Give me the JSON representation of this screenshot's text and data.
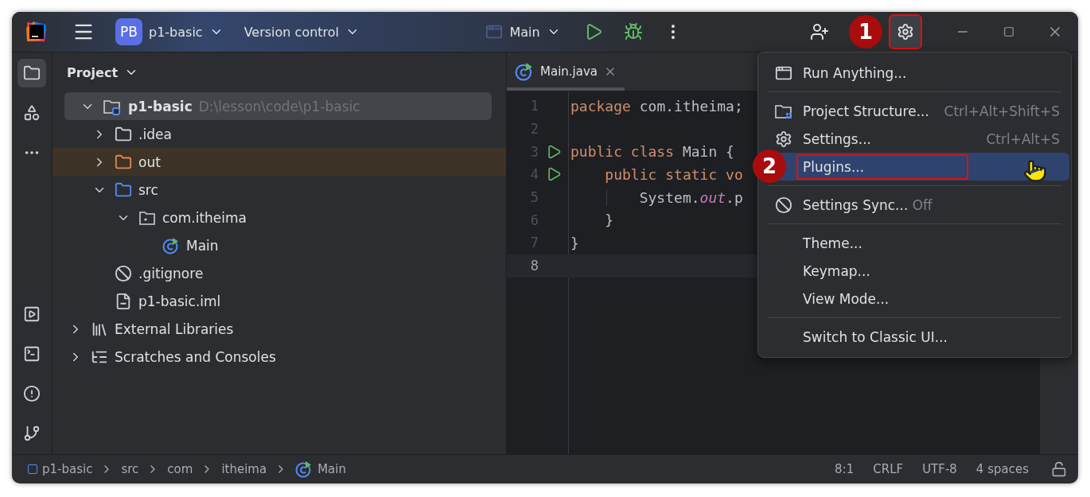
{
  "title_bar": {
    "project_badge": "PB",
    "project": "p1-basic",
    "vcs": "Version control",
    "run_config": "Main",
    "annotation": "1"
  },
  "left_toolbar": {
    "top": [
      {
        "kind": "project",
        "selected": true
      },
      {
        "kind": "structure",
        "selected": false
      },
      {
        "kind": "more",
        "selected": false
      }
    ],
    "bottom": [
      {
        "kind": "run",
        "selected": false
      },
      {
        "kind": "terminal",
        "selected": false
      },
      {
        "kind": "problems",
        "selected": false
      },
      {
        "kind": "git",
        "selected": false
      }
    ]
  },
  "project_panel": {
    "title": "Project",
    "tree": [
      {
        "kind": "module",
        "label": "p1-basic",
        "path": "D:\\lesson\\code\\p1-basic",
        "expanded": true,
        "selected": true,
        "children": [
          {
            "kind": "folder",
            "label": ".idea",
            "expanded": false,
            "selected": false
          },
          {
            "kind": "excluded",
            "label": "out",
            "expanded": false,
            "selected": false
          },
          {
            "kind": "source",
            "label": "src",
            "expanded": true,
            "selected": false,
            "children": [
              {
                "kind": "package",
                "label": "com.itheima",
                "expanded": true,
                "selected": false,
                "children": [
                  {
                    "kind": "class",
                    "label": "Main",
                    "selected": false
                  }
                ]
              }
            ]
          },
          {
            "kind": "ignore",
            "label": ".gitignore",
            "selected": false
          },
          {
            "kind": "iml",
            "label": "p1-basic.iml",
            "selected": false
          }
        ]
      },
      {
        "kind": "libraries",
        "label": "External Libraries",
        "expanded": false,
        "selected": false
      },
      {
        "kind": "scratches",
        "label": "Scratches and Consoles",
        "expanded": false,
        "selected": false
      }
    ]
  },
  "editor": {
    "tab": {
      "label": "Main.java",
      "selected": true
    },
    "lines": [
      {
        "number": "1",
        "run": false,
        "current": false,
        "tokens": [
          {
            "kind": "keyword",
            "text": "package "
          },
          {
            "kind": "plain",
            "text": "com.itheima;"
          }
        ]
      },
      {
        "number": "2",
        "run": false,
        "current": false
      },
      {
        "number": "3",
        "run": true,
        "current": false,
        "tokens": [
          {
            "kind": "keyword",
            "text": "public class "
          },
          {
            "kind": "plain",
            "text": "Main {"
          }
        ]
      },
      {
        "number": "4",
        "run": true,
        "current": false,
        "tokens": [
          {
            "kind": "keyword",
            "text": "    public static vo"
          }
        ]
      },
      {
        "number": "5",
        "run": false,
        "current": false,
        "indent": true,
        "tokens": [
          {
            "kind": "plain",
            "text": "        System."
          },
          {
            "kind": "field",
            "text": "out"
          },
          {
            "kind": "plain",
            "text": ".p"
          }
        ]
      },
      {
        "number": "6",
        "run": false,
        "current": false,
        "tokens": [
          {
            "kind": "plain",
            "text": "    }"
          }
        ]
      },
      {
        "number": "7",
        "run": false,
        "current": false,
        "tokens": [
          {
            "kind": "plain",
            "text": "}"
          }
        ]
      },
      {
        "number": "8",
        "run": false,
        "current": true
      }
    ]
  },
  "menu": {
    "annotation": "2",
    "items": [
      {
        "kind": "run",
        "label": "Run Anything...",
        "selected": false
      },
      {
        "kind": "separator"
      },
      {
        "kind": "structure",
        "label": "Project Structure...",
        "shortcut": "Ctrl+Alt+Shift+S",
        "selected": false
      },
      {
        "kind": "settings",
        "label": "Settings...",
        "shortcut": "Ctrl+Alt+S",
        "selected": false
      },
      {
        "kind": "plain",
        "label": "Plugins...",
        "selected": true
      },
      {
        "kind": "separator"
      },
      {
        "kind": "sync",
        "label": "Settings Sync...",
        "suffix": "Off",
        "selected": false
      },
      {
        "kind": "separator"
      },
      {
        "kind": "plain",
        "label": "Theme...",
        "selected": false
      },
      {
        "kind": "plain",
        "label": "Keymap...",
        "selected": false
      },
      {
        "kind": "plain",
        "label": "View Mode...",
        "selected": false
      },
      {
        "kind": "separator"
      },
      {
        "kind": "plain",
        "label": "Switch to Classic UI...",
        "selected": false
      }
    ]
  },
  "status_bar": {
    "breadcrumbs": [
      {
        "kind": "module",
        "label": "p1-basic"
      },
      {
        "kind": "folder",
        "label": "src"
      },
      {
        "kind": "folder",
        "label": "com"
      },
      {
        "kind": "folder",
        "label": "itheima"
      },
      {
        "kind": "class",
        "label": "Main"
      }
    ],
    "widgets": [
      "8:1",
      "CRLF",
      "UTF-8",
      "4 spaces"
    ]
  }
}
